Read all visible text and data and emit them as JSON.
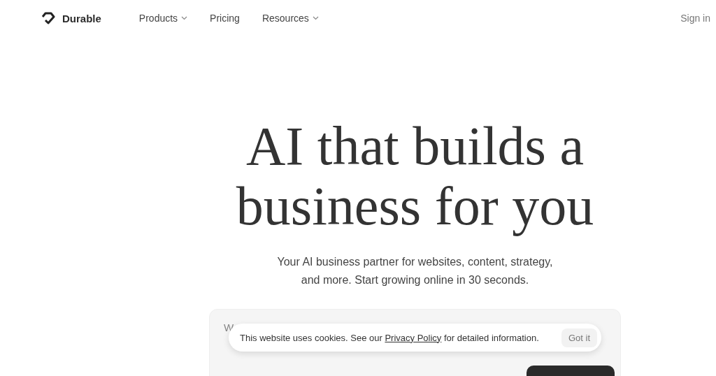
{
  "nav": {
    "brand": "Durable",
    "links": [
      {
        "label": "Products",
        "dropdown": true
      },
      {
        "label": "Pricing",
        "dropdown": false
      },
      {
        "label": "Resources",
        "dropdown": true
      }
    ],
    "sign_in": "Sign in"
  },
  "hero": {
    "heading_lines": [
      "AI that builds a",
      "business for you"
    ],
    "subtitle_lines": [
      "Your AI business partner for websites, content, strategy,",
      "and more. Start growing online in 30 seconds."
    ]
  },
  "prompt_card": {
    "placeholder": "W"
  },
  "cookie_banner": {
    "text_before": "This website uses cookies. See our",
    "link": "Privacy Policy",
    "text_after": "for detailed information.",
    "button": "Got it"
  }
}
